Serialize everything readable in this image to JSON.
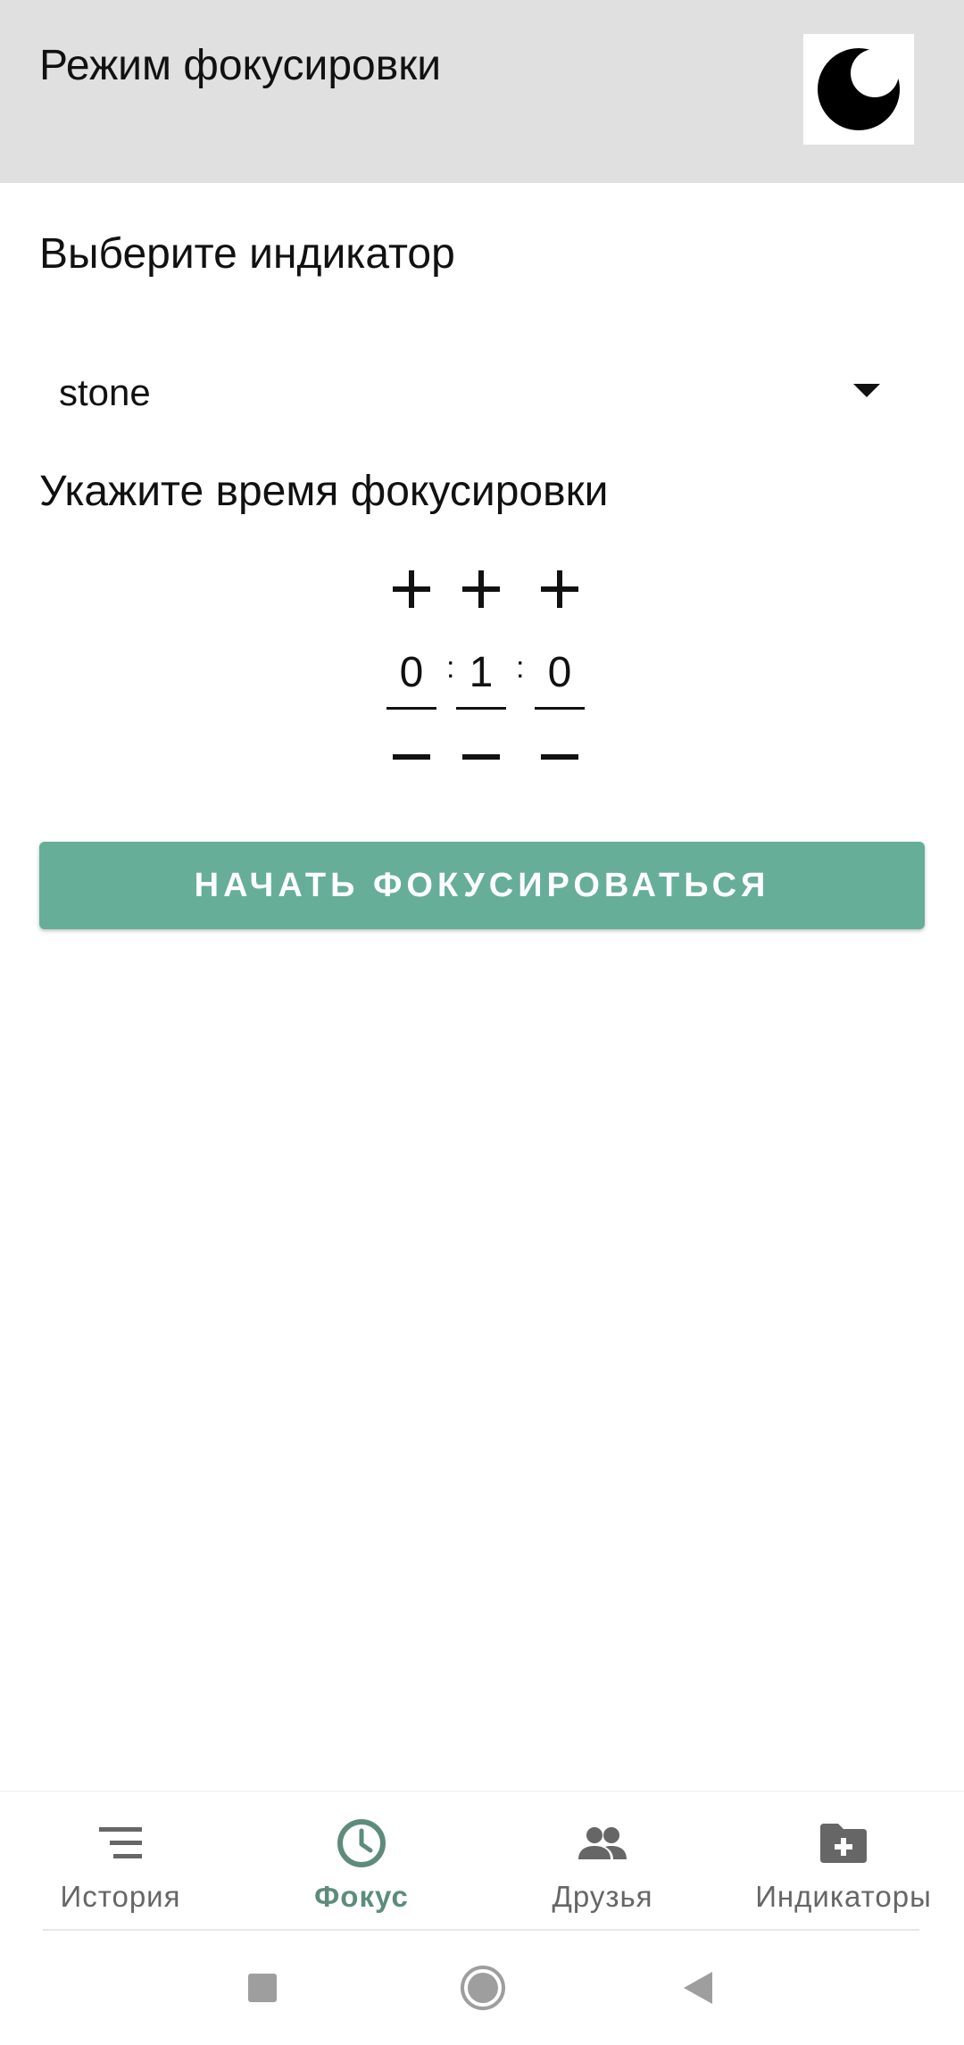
{
  "app_bar": {
    "title": "Режим фокусировки",
    "theme_icon": "moon-icon"
  },
  "indicator": {
    "label": "Выберите индикатор",
    "selected": "stone"
  },
  "timer": {
    "label": "Укажите время фокусировки",
    "hours": "0",
    "minutes": "1",
    "seconds": "0",
    "separator": ":"
  },
  "start_button": {
    "label": "НАЧАТЬ ФОКУСИРОВАТЬСЯ",
    "color": "#66ae97"
  },
  "bottom_nav": {
    "items": [
      {
        "label": "История",
        "icon": "list-icon",
        "active": false
      },
      {
        "label": "Фокус",
        "icon": "clock-icon",
        "active": true
      },
      {
        "label": "Друзья",
        "icon": "people-icon",
        "active": false
      },
      {
        "label": "Индикаторы",
        "icon": "folder-add-icon",
        "active": false
      }
    ],
    "active_color": "#5e8c7c",
    "inactive_color": "#666666"
  },
  "system_nav": {
    "buttons": [
      "recents-icon",
      "home-icon",
      "back-icon"
    ]
  }
}
